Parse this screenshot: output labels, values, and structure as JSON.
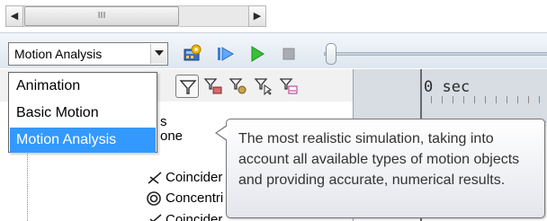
{
  "scrollbar": {
    "left_arrow": "◀",
    "right_arrow": "▶",
    "thumb_grip": "III"
  },
  "toolbar": {
    "study_type": {
      "selected": "Motion Analysis",
      "options": [
        "Animation",
        "Basic Motion",
        "Motion Analysis"
      ]
    },
    "icons": [
      "calculate-icon",
      "play-from-start-icon",
      "play-icon",
      "stop-icon"
    ]
  },
  "tree": {
    "filter_icons": [
      "filter-icon",
      "filter-animated-icon",
      "filter-driving-icon",
      "filter-selected-icon",
      "filter-results-icon"
    ],
    "items": [
      {
        "label": "Coincider",
        "icon": "coincident-mate-icon"
      },
      {
        "label": "Concentri",
        "icon": "concentric-mate-icon"
      },
      {
        "label": "Coincider",
        "icon": "coincident-mate-icon"
      }
    ],
    "partial_label_1": "s",
    "partial_label_2": "one"
  },
  "timeline": {
    "label": "0 sec"
  },
  "tooltip": {
    "text": "The most realistic simulation, taking into account all available types of motion objects and providing accurate, numerical results."
  },
  "colors": {
    "selection": "#3399ff",
    "toolbar_bg": "#e6edf4",
    "timeline_header": "#d7dde3"
  }
}
